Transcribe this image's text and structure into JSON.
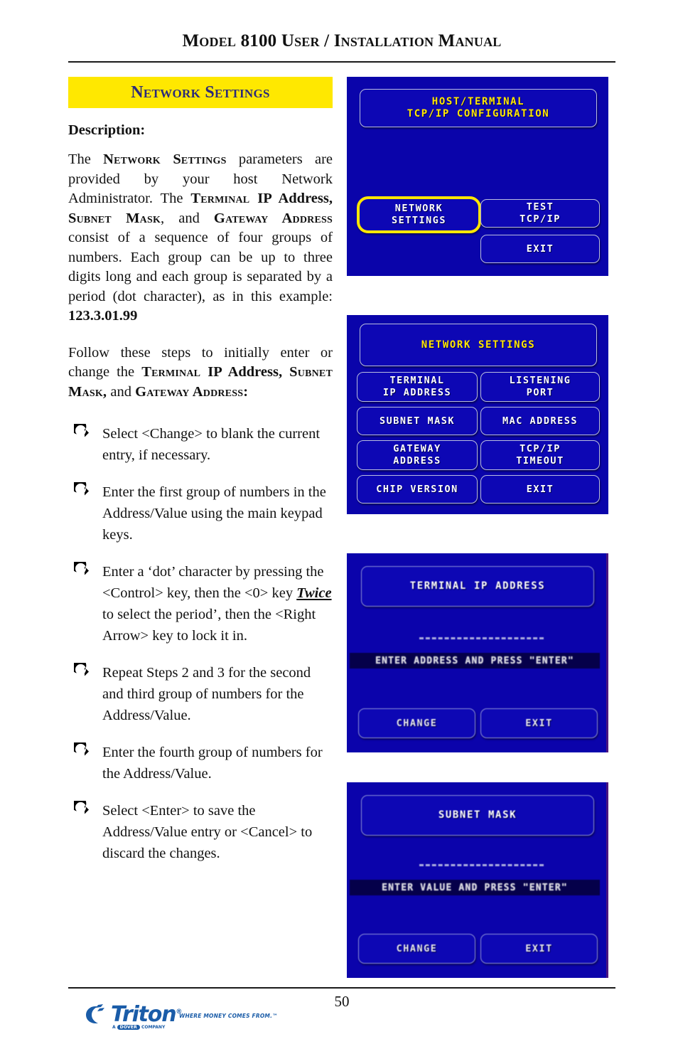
{
  "header": {
    "title": "Model 8100 User / Installation Manual"
  },
  "section": {
    "banner_title": "Network Settings",
    "description_heading": "Description:"
  },
  "paragraphs": {
    "p1_pre": "The ",
    "p1_sc1": "Network Settings",
    "p1_mid1": " parameters are provided by your host Network Administrator.  The ",
    "p1_sc2": "Terminal",
    "p1_b1": " IP Address, ",
    "p1_sc3": "Subnet Mask",
    "p1_mid2": ", and ",
    "p1_sc4": "Gateway Address",
    "p1_mid3": " consist  of a sequence of four groups of numbers. Each group can be up to three digits long and each group is separated by a period (dot character), as in this example: ",
    "p1_example": "123.3.01.99",
    "p2_pre": "Follow these steps to initially enter or change the ",
    "p2_sc1": "Terminal",
    "p2_b1": " IP Address, ",
    "p2_sc2": "Subnet Mask,",
    "p2_mid": " and ",
    "p2_sc3": "Gateway Address",
    "p2_end": ":"
  },
  "steps": [
    {
      "text": "Select <Change> to blank the current entry, if necessary."
    },
    {
      "text": "Enter the first group of numbers in the  Address/Value using the main keypad keys."
    },
    {
      "pre": "Enter a ‘dot’  character by pressing the <Control> key, then the <0> key ",
      "emph": "Twice",
      "post": " to select the period’, then the <Right Arrow> key to lock it in."
    },
    {
      "text": "Repeat Steps 2 and 3 for the second and third group of numbers for the Address/Value."
    },
    {
      "text": "Enter the fourth group of numbers for the  Address/Value."
    },
    {
      "text": "Select <Enter> to save the  Address/Value entry or <Cancel> to discard the changes."
    }
  ],
  "screens": [
    {
      "id": "screen-1",
      "title_line1": "HOST/TERMINAL",
      "title_line2": "TCP/IP CONFIGURATION",
      "buttons": [
        {
          "line1": "NETWORK",
          "line2": "SETTINGS",
          "selected": true
        },
        {
          "line1": "TEST",
          "line2": "TCP/IP",
          "selected": false
        },
        {
          "line1": "EXIT",
          "line2": "",
          "selected": false
        }
      ]
    },
    {
      "id": "screen-2",
      "title_line1": "NETWORK SETTINGS",
      "title_line2": "",
      "buttons": [
        {
          "line1": "TERMINAL",
          "line2": "IP ADDRESS"
        },
        {
          "line1": "LISTENING",
          "line2": "PORT"
        },
        {
          "line1": "SUBNET MASK",
          "line2": ""
        },
        {
          "line1": "MAC ADDRESS",
          "line2": ""
        },
        {
          "line1": "GATEWAY",
          "line2": "ADDRESS"
        },
        {
          "line1": "TCP/IP",
          "line2": "TIMEOUT"
        },
        {
          "line1": "CHIP VERSION",
          "line2": ""
        },
        {
          "line1": "EXIT",
          "line2": ""
        }
      ]
    },
    {
      "id": "screen-3",
      "title_line1": "TERMINAL IP ADDRESS",
      "prompt": "ENTER ADDRESS AND PRESS \"ENTER\"",
      "buttons": [
        {
          "line1": "CHANGE",
          "line2": ""
        },
        {
          "line1": "EXIT",
          "line2": ""
        }
      ]
    },
    {
      "id": "screen-4",
      "title_line1": "SUBNET MASK",
      "prompt": "ENTER VALUE AND PRESS \"ENTER\"",
      "buttons": [
        {
          "line1": "CHANGE",
          "line2": ""
        },
        {
          "line1": "EXIT",
          "line2": ""
        }
      ]
    }
  ],
  "footer": {
    "page_number": "50",
    "logo_word": "Triton",
    "logo_registered": "®",
    "logo_tagline": "WHERE MONEY COMES FROM.™",
    "logo_dover_pre": "A",
    "logo_dover_brand": "DOVER",
    "logo_dover_post": "COMPANY"
  },
  "colors": {
    "banner_yellow": "#ffe800",
    "banner_text": "#2b2a7a",
    "lcd_background": "#0a04aa",
    "lcd_button": "#0d07b4",
    "lcd_title_text": "#ffe600",
    "lcd_button_text": "#ffffff",
    "selection_ring": "#ffe600",
    "logo_blue": "#1a5ca8"
  }
}
